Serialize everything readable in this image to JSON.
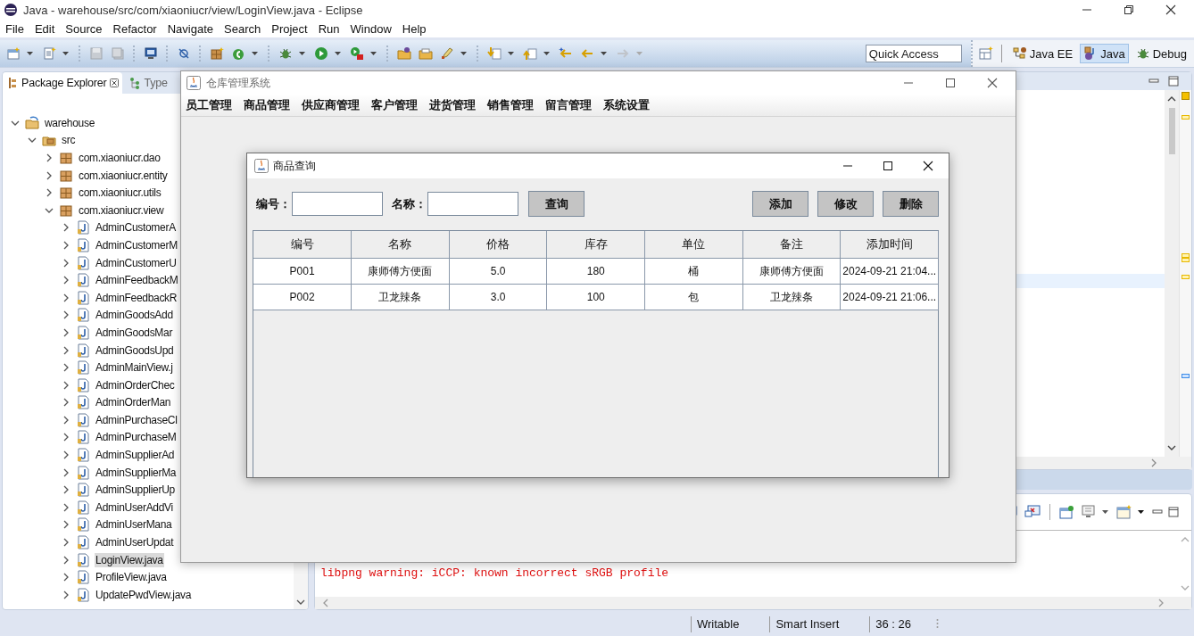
{
  "eclipse": {
    "title": "Java - warehouse/src/com/xiaoniucr/view/LoginView.java - Eclipse",
    "menu": [
      "File",
      "Edit",
      "Source",
      "Refactor",
      "Navigate",
      "Search",
      "Project",
      "Run",
      "Window",
      "Help"
    ],
    "quick_access": {
      "placeholder": "Quick Access"
    },
    "perspectives": [
      {
        "label": "Java EE",
        "selected": false
      },
      {
        "label": "Java",
        "selected": true
      },
      {
        "label": "Debug",
        "selected": false
      }
    ],
    "explorer": {
      "tabs": [
        {
          "label": "Package Explorer",
          "selected": true
        },
        {
          "label": "Type",
          "selected": false
        }
      ],
      "tree": [
        {
          "label": "warehouse",
          "kind": "project",
          "expanded": true,
          "selected": false,
          "children": [
            {
              "label": "src",
              "kind": "source",
              "expanded": true,
              "selected": false,
              "children": [
                {
                  "label": "com.xiaoniucr.dao",
                  "kind": "package",
                  "expanded": false,
                  "selected": false
                },
                {
                  "label": "com.xiaoniucr.entity",
                  "kind": "package",
                  "expanded": false,
                  "selected": false
                },
                {
                  "label": "com.xiaoniucr.utils",
                  "kind": "package",
                  "expanded": false,
                  "selected": false
                },
                {
                  "label": "com.xiaoniucr.view",
                  "kind": "package",
                  "expanded": true,
                  "selected": false,
                  "children": [
                    {
                      "label": "AdminCustomerA",
                      "kind": "java",
                      "expanded": false,
                      "selected": false
                    },
                    {
                      "label": "AdminCustomerM",
                      "kind": "java",
                      "expanded": false,
                      "selected": false
                    },
                    {
                      "label": "AdminCustomerU",
                      "kind": "java",
                      "expanded": false,
                      "selected": false
                    },
                    {
                      "label": "AdminFeedbackM",
                      "kind": "java",
                      "expanded": false,
                      "selected": false
                    },
                    {
                      "label": "AdminFeedbackR",
                      "kind": "java",
                      "expanded": false,
                      "selected": false
                    },
                    {
                      "label": "AdminGoodsAdd",
                      "kind": "java",
                      "expanded": false,
                      "selected": false
                    },
                    {
                      "label": "AdminGoodsMar",
                      "kind": "java",
                      "expanded": false,
                      "selected": false
                    },
                    {
                      "label": "AdminGoodsUpd",
                      "kind": "java",
                      "expanded": false,
                      "selected": false
                    },
                    {
                      "label": "AdminMainView.j",
                      "kind": "java",
                      "expanded": false,
                      "selected": false
                    },
                    {
                      "label": "AdminOrderChec",
                      "kind": "java",
                      "expanded": false,
                      "selected": false
                    },
                    {
                      "label": "AdminOrderMan",
                      "kind": "java",
                      "expanded": false,
                      "selected": false
                    },
                    {
                      "label": "AdminPurchaseCl",
                      "kind": "java",
                      "expanded": false,
                      "selected": false
                    },
                    {
                      "label": "AdminPurchaseM",
                      "kind": "java",
                      "expanded": false,
                      "selected": false
                    },
                    {
                      "label": "AdminSupplierAd",
                      "kind": "java",
                      "expanded": false,
                      "selected": false
                    },
                    {
                      "label": "AdminSupplierMa",
                      "kind": "java",
                      "expanded": false,
                      "selected": false
                    },
                    {
                      "label": "AdminSupplierUp",
                      "kind": "java",
                      "expanded": false,
                      "selected": false
                    },
                    {
                      "label": "AdminUserAddVi",
                      "kind": "java",
                      "expanded": false,
                      "selected": false
                    },
                    {
                      "label": "AdminUserMana",
                      "kind": "java",
                      "expanded": false,
                      "selected": false
                    },
                    {
                      "label": "AdminUserUpdat",
                      "kind": "java",
                      "expanded": false,
                      "selected": false
                    },
                    {
                      "label": "LoginView.java",
                      "kind": "java",
                      "expanded": false,
                      "selected": true
                    },
                    {
                      "label": "ProfileView.java",
                      "kind": "java",
                      "expanded": false,
                      "selected": false
                    },
                    {
                      "label": "UpdatePwdView.java",
                      "kind": "java",
                      "expanded": false,
                      "selected": false
                    }
                  ]
                }
              ]
            }
          ]
        }
      ]
    },
    "console": {
      "lines": [
        "libpng warning: iCCP: known incorrect sRGB profile"
      ]
    },
    "status_bar": [
      "Writable",
      "Smart Insert",
      "36 : 26"
    ]
  },
  "app_window": {
    "title": "仓库管理系统",
    "menu": [
      "员工管理",
      "商品管理",
      "供应商管理",
      "客户管理",
      "进货管理",
      "销售管理",
      "留言管理",
      "系统设置"
    ]
  },
  "dialog": {
    "title": "商品查询",
    "fields": [
      {
        "label": "编号："
      },
      {
        "label": "名称："
      }
    ],
    "search_button": "查询",
    "action_buttons": [
      "添加",
      "修改",
      "删除"
    ],
    "table": {
      "columns": [
        "编号",
        "名称",
        "价格",
        "库存",
        "单位",
        "备注",
        "添加时间"
      ],
      "rows": [
        [
          "P001",
          "康师傅方便面",
          "5.0",
          "180",
          "桶",
          "康师傅方便面",
          "2024-09-21 21:04..."
        ],
        [
          "P002",
          "卫龙辣条",
          "3.0",
          "100",
          "包",
          "卫龙辣条",
          "2024-09-21 21:06..."
        ]
      ]
    }
  }
}
